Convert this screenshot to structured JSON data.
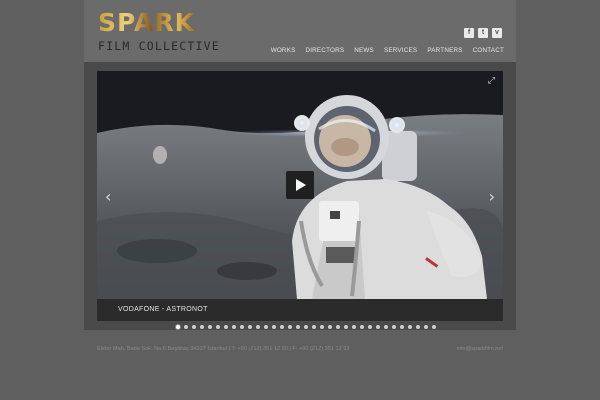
{
  "logo": {
    "name": "SPARK",
    "tagline": "FILM COLLECTIVE"
  },
  "social": [
    {
      "icon": "facebook-icon",
      "glyph": "f"
    },
    {
      "icon": "twitter-icon",
      "glyph": "t"
    },
    {
      "icon": "vimeo-icon",
      "glyph": "v"
    }
  ],
  "nav": [
    "WORKS",
    "DIRECTORS",
    "NEWS",
    "SERVICES",
    "PARTNERS",
    "CONTACT"
  ],
  "slider": {
    "caption": "VODAFONE - ASTRONOT",
    "prev_glyph": "‹",
    "next_glyph": "›",
    "fullscreen_glyph": "⤢",
    "slide_count": 33,
    "active_slide": 1
  },
  "footer": {
    "address": "Elider Mah. Bade Sok. No:6 Beşiktaş 34337 İstanbul | T: +90 (212) 351 12 90 | F: +90 (212) 351 12 92",
    "email": "info@sparkfilm.net"
  },
  "colors": {
    "page_background": "#5f5f5f",
    "header_background": "#6b6b6b",
    "content_background": "#4a4a4a",
    "logo_gold": "#d4a84a"
  }
}
